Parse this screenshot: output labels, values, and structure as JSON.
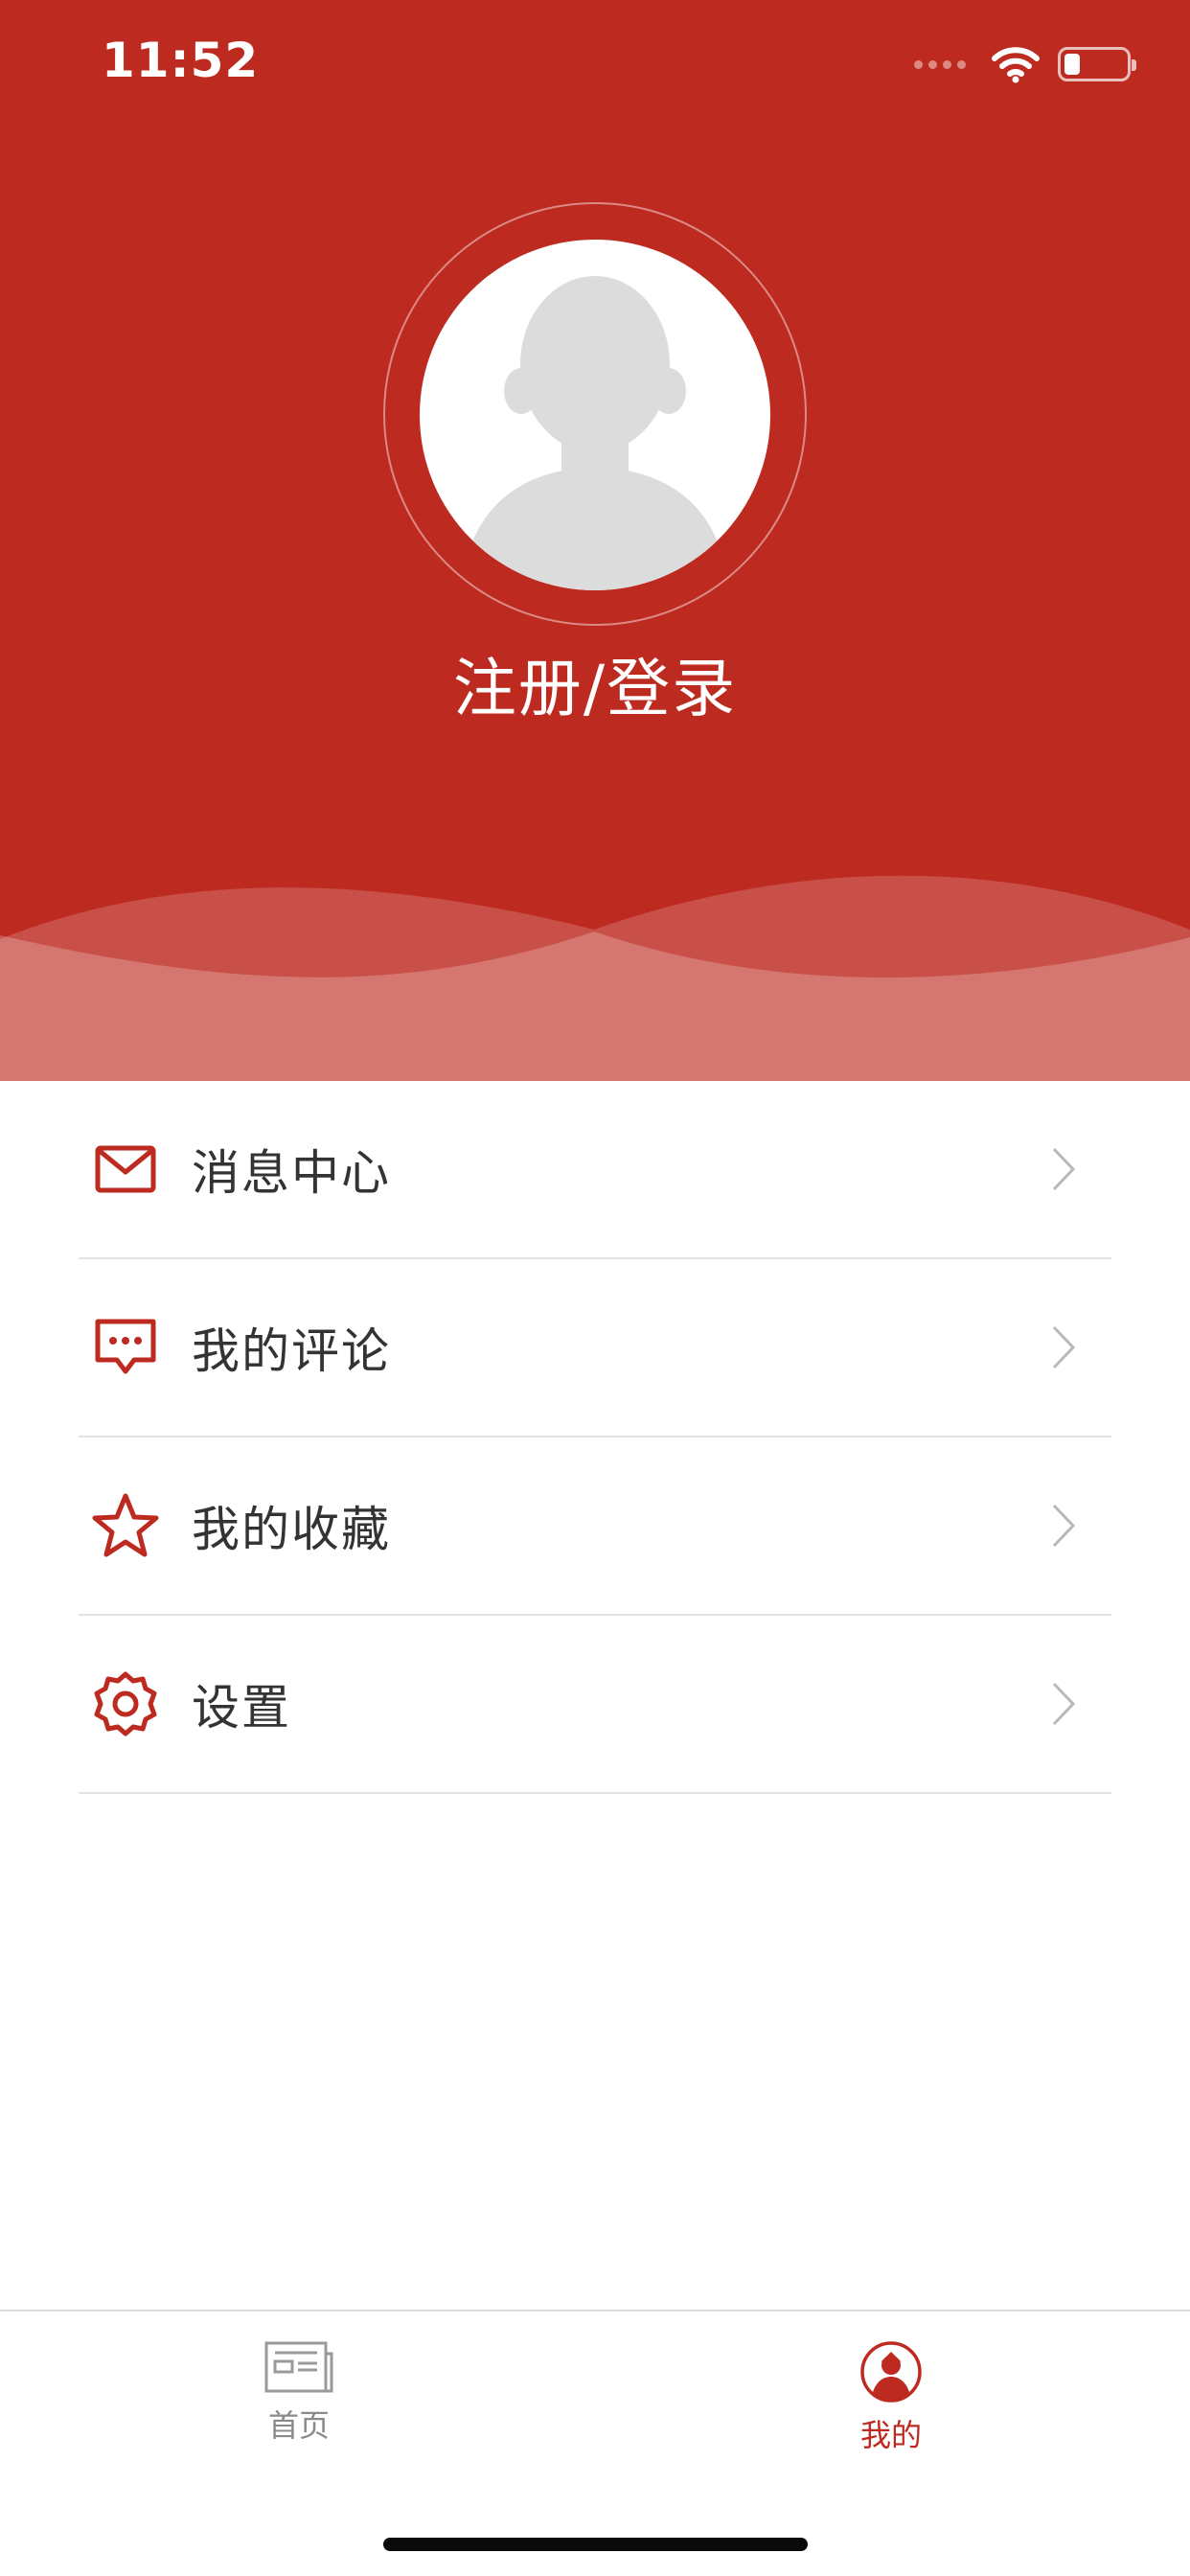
{
  "status_bar": {
    "time": "11:52"
  },
  "profile": {
    "login_label": "注册/登录"
  },
  "menu": {
    "items": [
      {
        "label": "消息中心",
        "icon": "mail-icon"
      },
      {
        "label": "我的评论",
        "icon": "comment-icon"
      },
      {
        "label": "我的收藏",
        "icon": "star-icon"
      },
      {
        "label": "设置",
        "icon": "gear-icon"
      }
    ]
  },
  "tabbar": {
    "tabs": [
      {
        "label": "首页",
        "icon": "newspaper-icon",
        "active": false
      },
      {
        "label": "我的",
        "icon": "user-icon",
        "active": true
      }
    ]
  },
  "colors": {
    "brand_red": "#bd2a20",
    "text_dark": "#333333",
    "tab_inactive": "#8a8a8a",
    "divider": "#e3e3e3"
  }
}
